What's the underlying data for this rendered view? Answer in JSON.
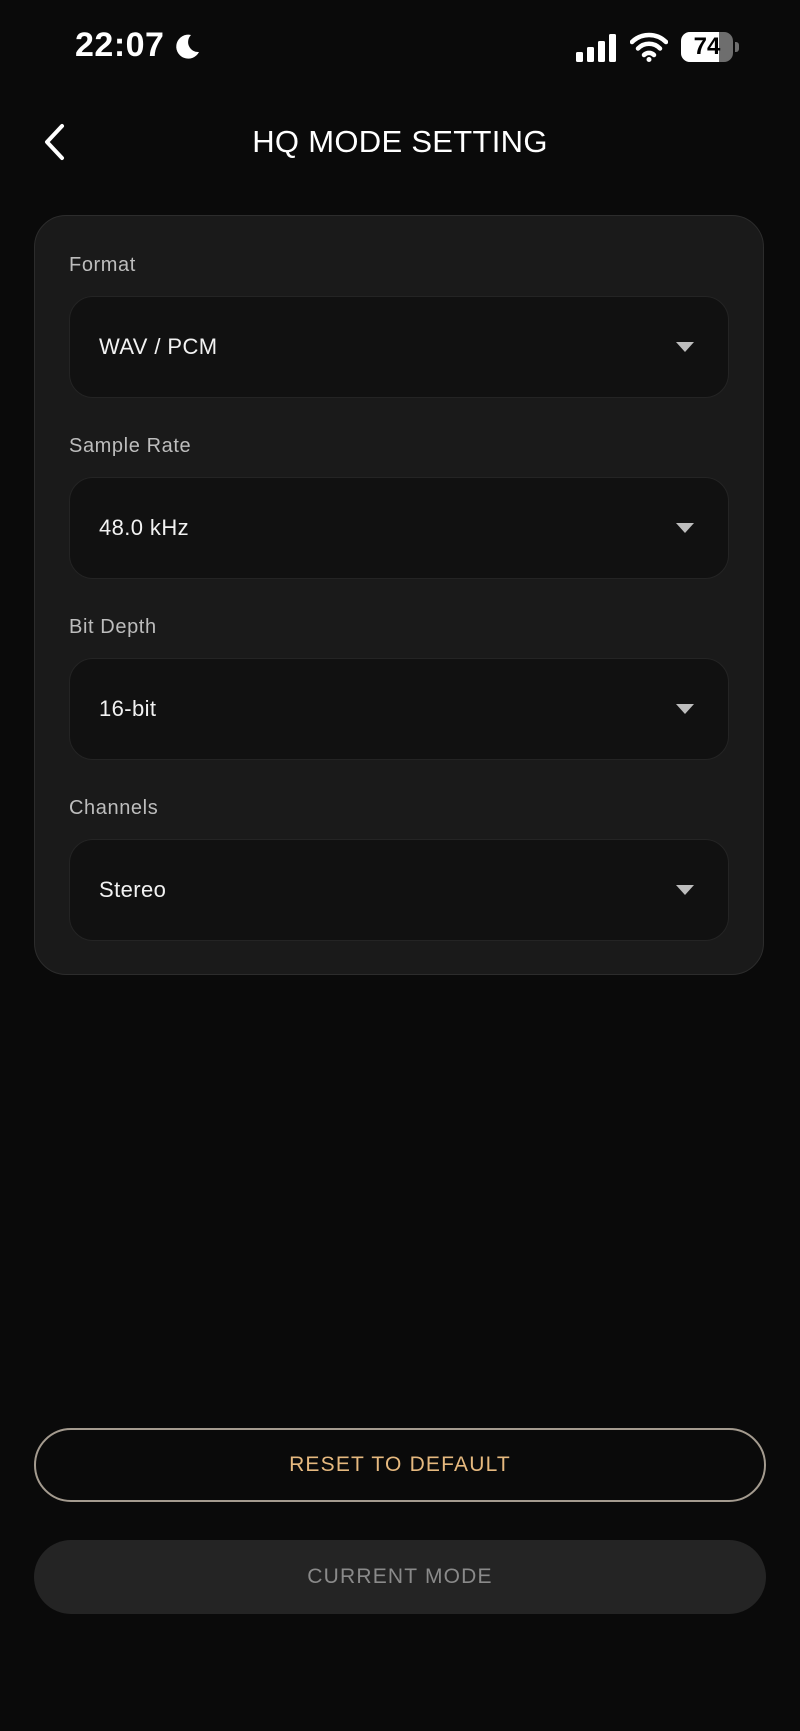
{
  "status_bar": {
    "time": "22:07",
    "battery_level": "74",
    "battery_fraction": 0.74,
    "icons": [
      "moon-icon",
      "signal-icon",
      "wifi-icon",
      "battery-icon"
    ]
  },
  "header": {
    "title": "HQ MODE SETTING",
    "back_icon": "chevron-left-icon"
  },
  "settings": {
    "fields": [
      {
        "label": "Format",
        "value": "WAV / PCM"
      },
      {
        "label": "Sample Rate",
        "value": "48.0 kHz"
      },
      {
        "label": "Bit Depth",
        "value": "16-bit"
      },
      {
        "label": "Channels",
        "value": "Stereo"
      }
    ]
  },
  "buttons": {
    "reset_label": "RESET TO DEFAULT",
    "current_mode_label": "CURRENT MODE"
  },
  "colors": {
    "background": "#0a0a0a",
    "card": "#1a1a1a",
    "accent": "#e6b97f",
    "muted_text": "#8a8a8a"
  }
}
